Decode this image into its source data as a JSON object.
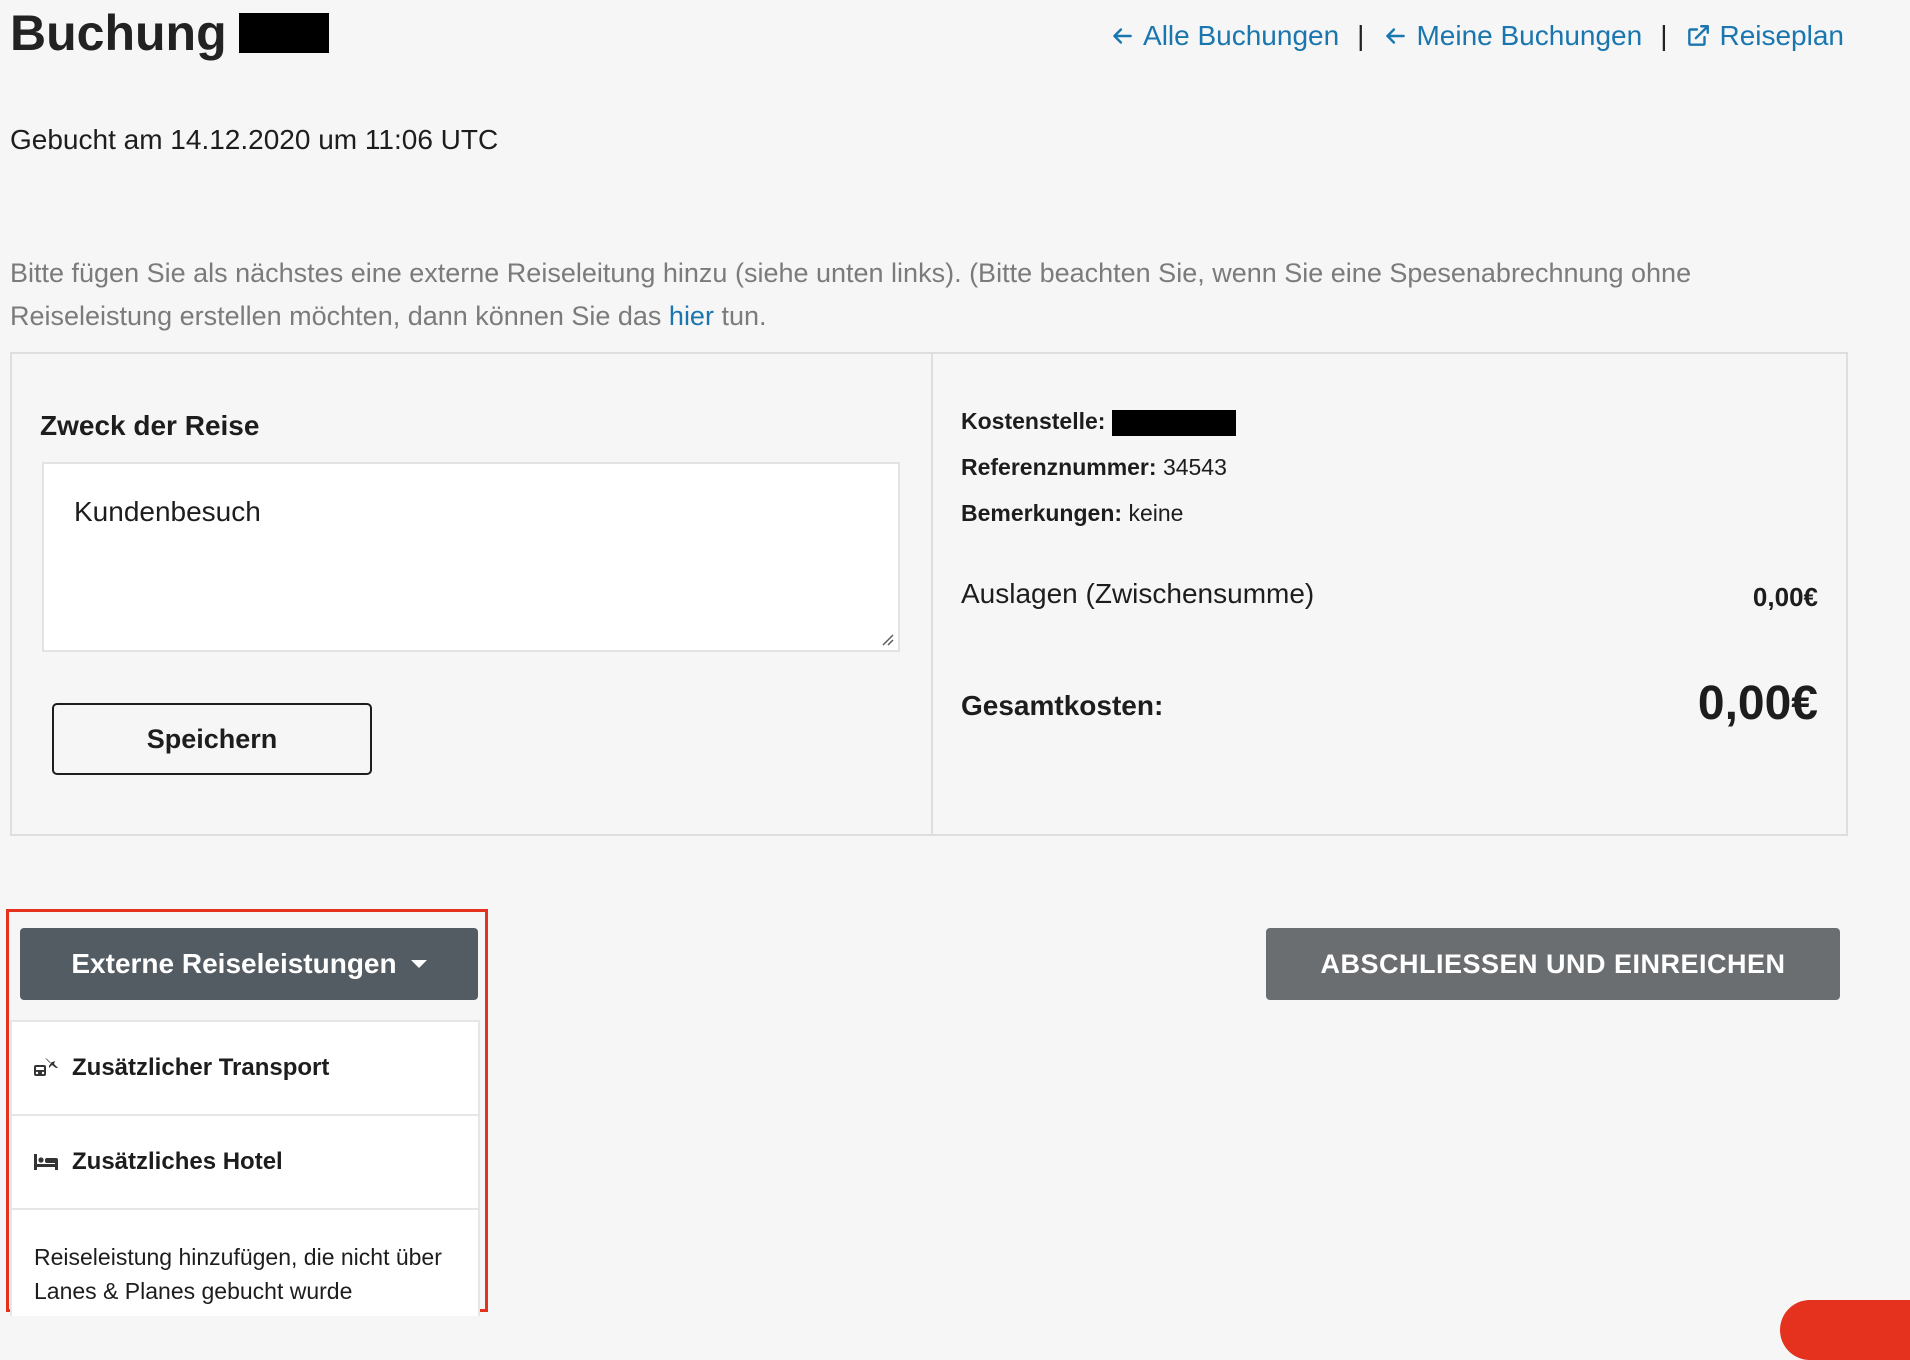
{
  "header": {
    "title": "Buchung",
    "links": [
      {
        "label": "Alle Buchungen",
        "icon": "arrow-left-icon"
      },
      {
        "label": "Meine Buchungen",
        "icon": "arrow-left-icon"
      },
      {
        "label": "Reiseplan",
        "icon": "external-link-icon"
      }
    ],
    "separator": "|"
  },
  "booked_text": "Gebucht am 14.12.2020 um 11:06 UTC",
  "info": {
    "text_before": "Bitte fügen Sie als nächstes eine externe Reiseleitung hinzu (siehe unten links). (Bitte beachten Sie, wenn Sie eine Spesenabrechnung ohne Reiseleistung erstellen möchten, dann können Sie das ",
    "link": "hier",
    "text_after": " tun."
  },
  "purpose": {
    "label": "Zweck der Reise",
    "value": "Kundenbesuch",
    "save_label": "Speichern"
  },
  "details": {
    "kostenstelle_label": "Kostenstelle:",
    "referenz_label": "Referenznummer:",
    "referenz_value": "34543",
    "bemerkungen_label": "Bemerkungen:",
    "bemerkungen_value": "keine",
    "auslagen_label": "Auslagen (Zwischensumme)",
    "auslagen_value": "0,00€",
    "gesamt_label": "Gesamtkosten:",
    "gesamt_value": "0,00€"
  },
  "dropdown": {
    "label": "Externe Reiseleistungen",
    "items": [
      {
        "label": "Zusätzlicher Transport",
        "icon": "transport-icon"
      },
      {
        "label": "Zusätzliches Hotel",
        "icon": "bed-icon"
      }
    ],
    "note": "Reiseleistung hinzufügen, die nicht über Lanes & Planes gebucht wurde"
  },
  "submit_label": "ABSCHLIESSEN UND EINREICHEN",
  "colors": {
    "link": "#1a76ae",
    "dropdown_bg": "#535b63",
    "submit_bg": "#6b6e71",
    "highlight": "#e5321f"
  }
}
